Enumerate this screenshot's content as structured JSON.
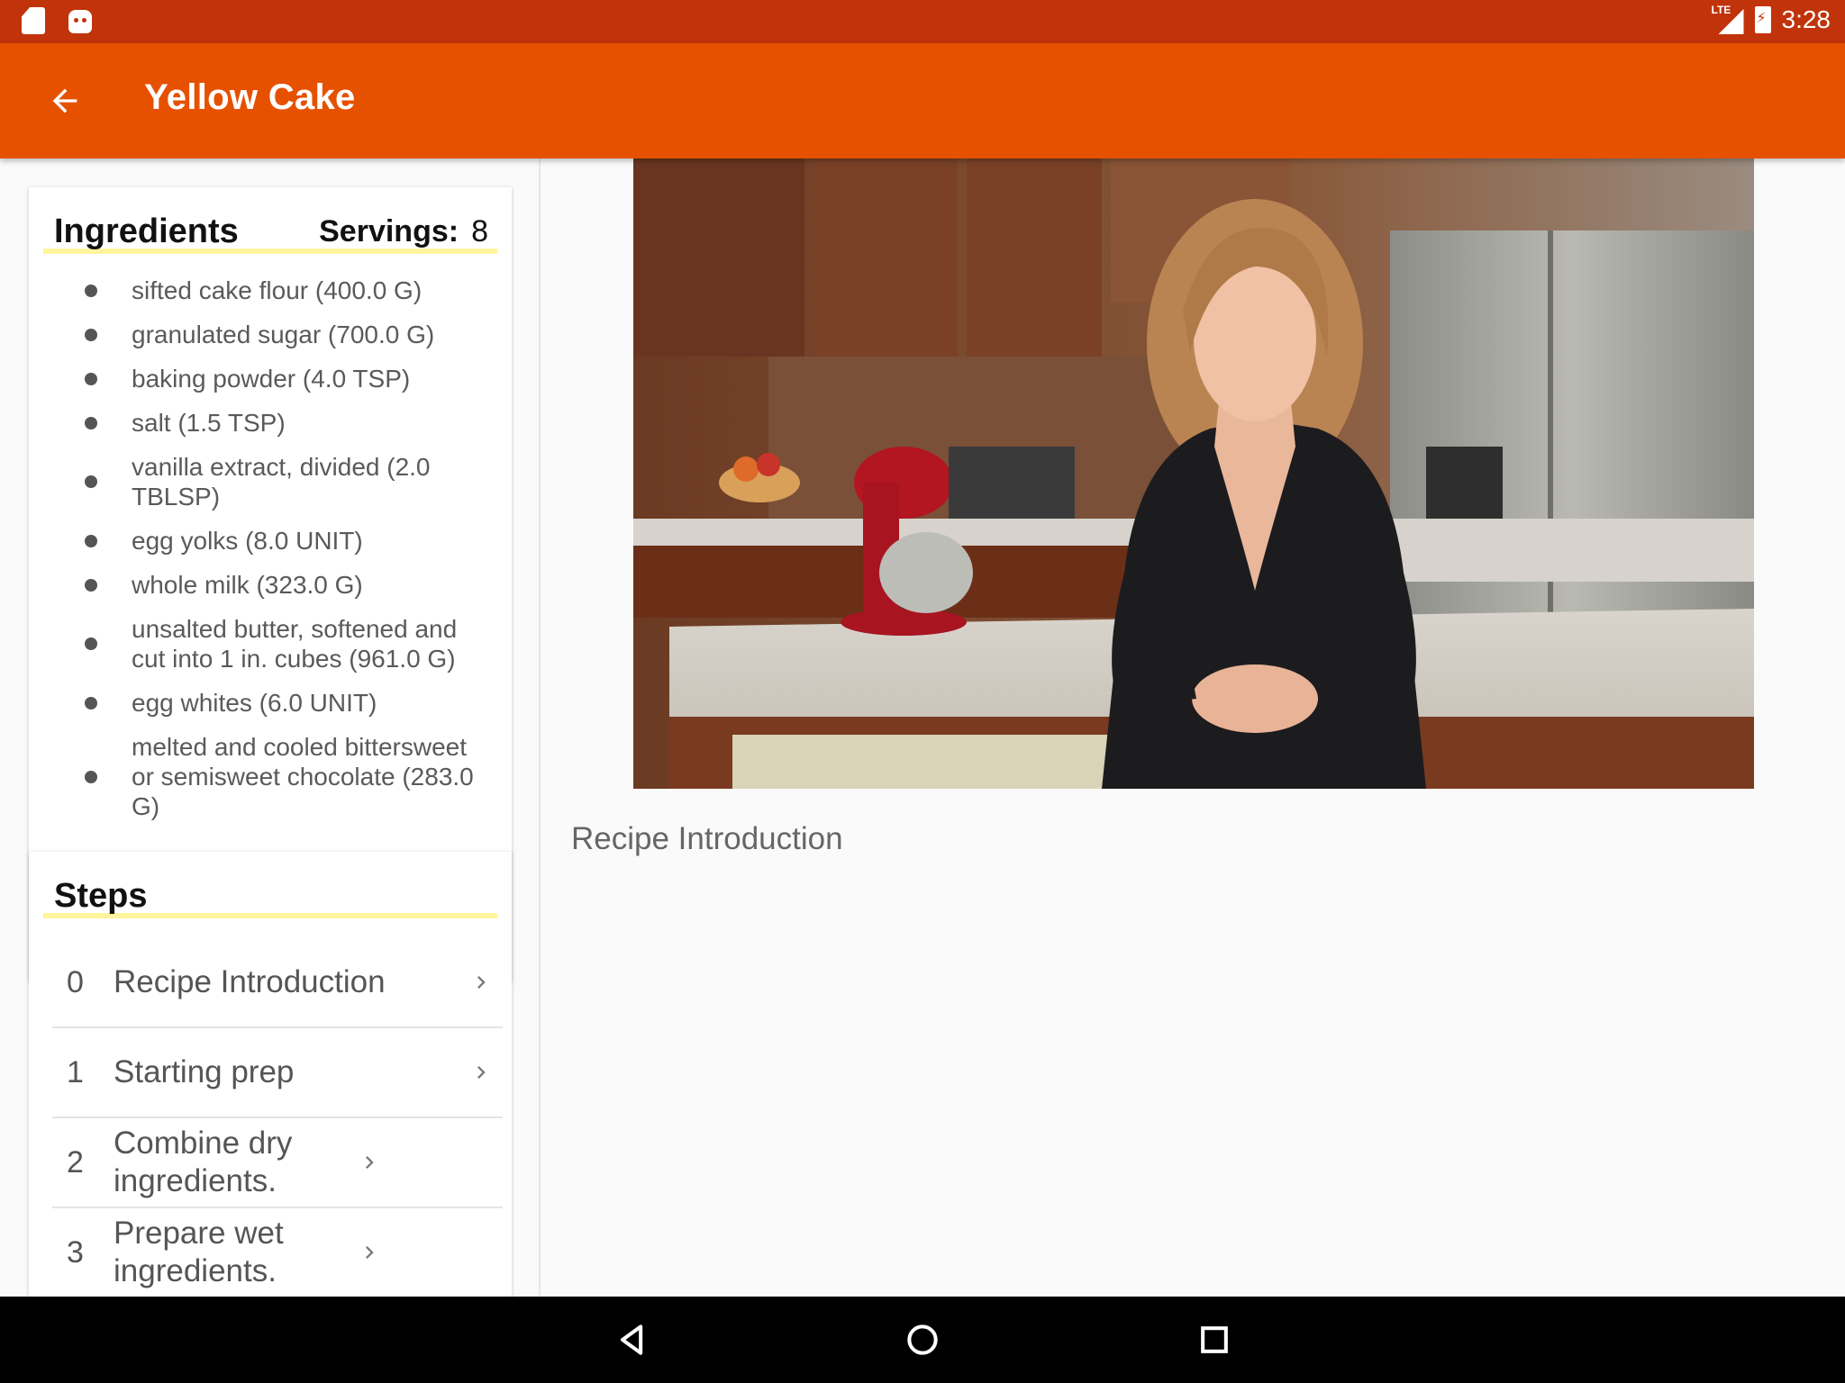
{
  "status_bar": {
    "time": "3:28",
    "network": "LTE"
  },
  "app_bar": {
    "title": "Yellow Cake"
  },
  "ingredients": {
    "title": "Ingredients",
    "servings_label": "Servings:",
    "servings_value": "8",
    "items": [
      "sifted cake flour  (400.0 G)",
      "granulated sugar  (700.0 G)",
      "baking powder  (4.0 TSP)",
      "salt  (1.5 TSP)",
      "vanilla extract, divided  (2.0 TBLSP)",
      "egg yolks  (8.0 UNIT)",
      "whole milk  (323.0 G)",
      "unsalted butter, softened and cut into 1 in. cubes  (961.0 G)",
      "egg whites  (6.0 UNIT)",
      "melted and cooled bittersweet or semisweet chocolate  (283.0 G)"
    ]
  },
  "steps": {
    "title": "Steps",
    "items": [
      {
        "number": "0",
        "label": "Recipe Introduction"
      },
      {
        "number": "1",
        "label": "Starting prep"
      },
      {
        "number": "2",
        "label": "Combine dry ingredients."
      },
      {
        "number": "3",
        "label": "Prepare wet ingredients."
      }
    ]
  },
  "detail": {
    "description": "Recipe Introduction"
  },
  "colors": {
    "status_bar": "#c1330b",
    "app_bar": "#e65100",
    "header_underline": "#fff59d"
  },
  "icons": {
    "back": "arrow-left-icon",
    "chevron": "chevron-right-icon",
    "nav_back": "triangle-back-icon",
    "nav_home": "circle-home-icon",
    "nav_recents": "square-recents-icon"
  }
}
